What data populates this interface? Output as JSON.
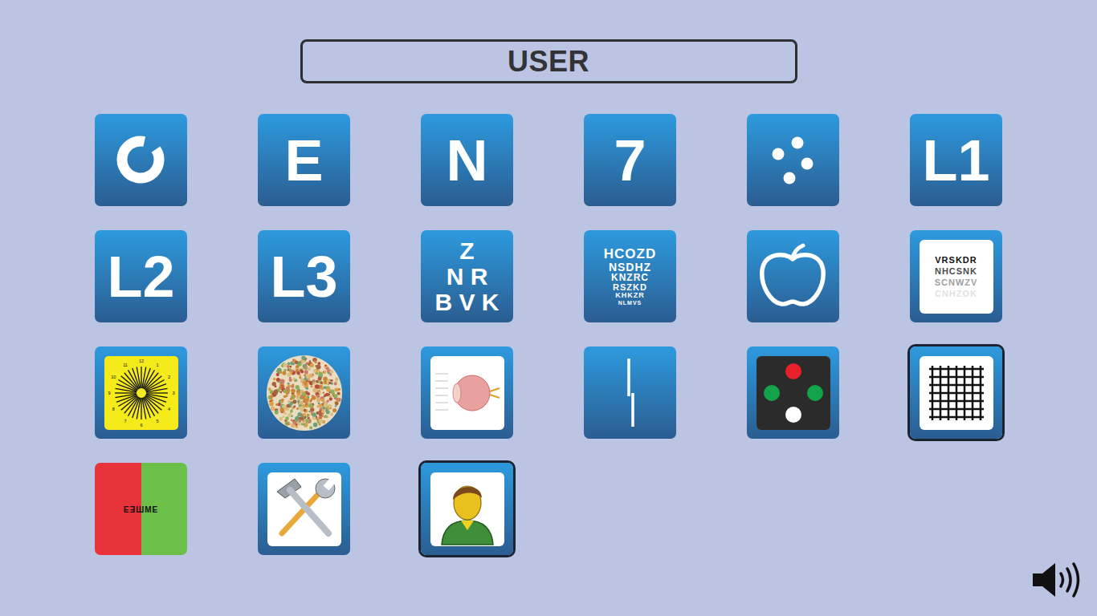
{
  "title": "USER",
  "tiles": [
    {
      "kind": "landolt",
      "selected": false
    },
    {
      "kind": "glyph",
      "label": "E",
      "selected": false
    },
    {
      "kind": "glyph",
      "label": "N",
      "selected": false
    },
    {
      "kind": "glyph",
      "label": "7",
      "selected": false
    },
    {
      "kind": "dots",
      "selected": false
    },
    {
      "kind": "glyph",
      "label": "L1",
      "selected": false
    },
    {
      "kind": "glyph",
      "label": "L2",
      "selected": false
    },
    {
      "kind": "glyph",
      "label": "L3",
      "selected": false
    },
    {
      "kind": "pyramid",
      "lines": [
        "Z",
        "N R",
        "B V K"
      ],
      "selected": false
    },
    {
      "kind": "chart",
      "lines": [
        "HCOZD",
        "NSDHZ",
        "KNZRC",
        "RSZKD",
        "KHKZR",
        "NLMVS"
      ],
      "selected": false
    },
    {
      "kind": "apple",
      "selected": false
    },
    {
      "kind": "contrast",
      "lines": [
        {
          "text": "VRSKDR",
          "contrast": 1
        },
        {
          "text": "NHCSNK",
          "contrast": 0.75
        },
        {
          "text": "SCNWZV",
          "contrast": 0.4
        },
        {
          "text": "CNHZOK",
          "contrast": 0.12
        }
      ],
      "selected": false
    },
    {
      "kind": "fan",
      "hours": [
        "12",
        "1",
        "2",
        "3",
        "4",
        "5",
        "6",
        "7",
        "8",
        "9",
        "10",
        "11"
      ],
      "selected": false
    },
    {
      "kind": "ishihara",
      "selected": false
    },
    {
      "kind": "anatomy",
      "selected": false
    },
    {
      "kind": "vernier",
      "selected": false
    },
    {
      "kind": "worth",
      "dots": [
        {
          "color": "#e8202a"
        },
        {
          "color": "#13a44b"
        },
        {
          "color": "#13a44b"
        },
        {
          "color": "#ffffff"
        }
      ],
      "selected": false
    },
    {
      "kind": "amsler",
      "selected": true
    },
    {
      "kind": "duochrome",
      "label": "EƎШME",
      "selected": false
    },
    {
      "kind": "tools",
      "selected": false
    },
    {
      "kind": "person",
      "selected": true
    }
  ],
  "sound": {
    "muted": false
  }
}
